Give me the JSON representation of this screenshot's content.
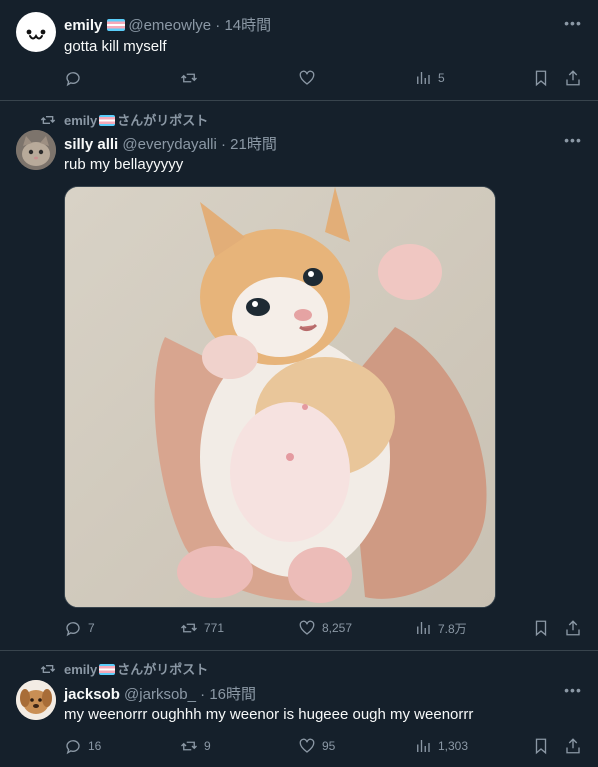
{
  "tweets": [
    {
      "name": "emily",
      "handle": "@emeowlye",
      "sep": "·",
      "time": "14時間",
      "text": "gotta kill myself",
      "avatar_emoji": "ω",
      "stats": {
        "replies": "",
        "retweets": "",
        "likes": "",
        "views": "5"
      }
    },
    {
      "retweeted_by": "emily",
      "retweeted_suffix": "さんがリポスト",
      "name": "silly alli",
      "handle": "@everydayalli",
      "sep": "·",
      "time": "21時間",
      "text": "rub my bellayyyyy",
      "stats": {
        "replies": "7",
        "retweets": "771",
        "likes": "8,257",
        "views": "7.8万"
      }
    },
    {
      "retweeted_by": "emily",
      "retweeted_suffix": "さんがリポスト",
      "name": "jacksob",
      "handle": "@jarksob_",
      "sep": "·",
      "time": "16時間",
      "text": "my weenorrr oughhh my weenor is hugeee ough my weenorrr",
      "stats": {
        "replies": "16",
        "retweets": "9",
        "likes": "95",
        "views": "1,303"
      }
    }
  ],
  "more_glyph": "•••",
  "colors": {
    "bg": "#15202b",
    "text": "#f7f9f9",
    "muted": "#8b98a5",
    "border": "#38444d"
  }
}
